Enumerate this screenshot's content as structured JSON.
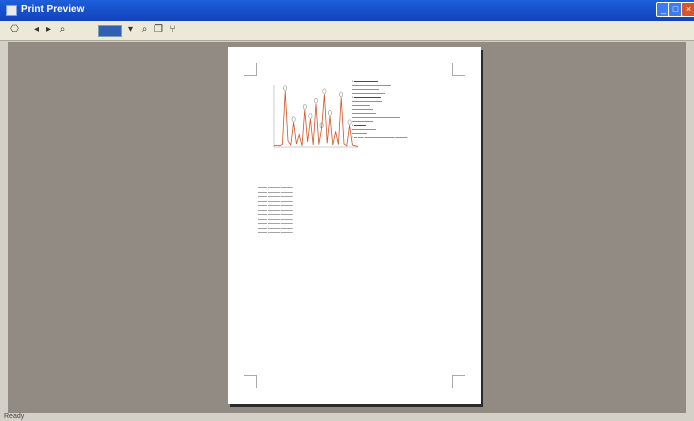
{
  "window": {
    "title": "Print Preview",
    "controls": [
      "minimize",
      "maximize",
      "close"
    ],
    "accent": "#1d5fdc"
  },
  "toolbar": {
    "buttons": [
      {
        "icon": "print-icon",
        "glyph": "⎔"
      },
      {
        "icon": "nav-back-icon",
        "glyph": "◂"
      },
      {
        "icon": "nav-forward-icon",
        "glyph": "▸"
      },
      {
        "icon": "zoom-in-icon",
        "glyph": "⌕"
      },
      {
        "icon": "zoom-select-icon",
        "glyph": ""
      },
      {
        "icon": "zoom-dropdown-icon",
        "glyph": "▾"
      },
      {
        "icon": "zoom-out-icon",
        "glyph": "⌕"
      },
      {
        "icon": "page-setup-icon",
        "glyph": "❐"
      },
      {
        "icon": "export-icon",
        "glyph": "⑂"
      }
    ]
  },
  "status": {
    "text": "Ready"
  },
  "page": {
    "chart": {
      "type": "line",
      "colors": {
        "primary": "#d2552a",
        "secondary": "#f0a070",
        "axis": "#999999"
      }
    },
    "legend_markers": [
      "○",
      "○",
      "○",
      "○",
      "○",
      "○",
      "○"
    ]
  },
  "chart_data": {
    "type": "line",
    "x": [
      0,
      1,
      2,
      3,
      4,
      5,
      6,
      7,
      8,
      9,
      10,
      11,
      12,
      13,
      14,
      15,
      16,
      17,
      18,
      19,
      20,
      21,
      22,
      23,
      24,
      25,
      26,
      27,
      28,
      29,
      30
    ],
    "series": [
      {
        "values": [
          2,
          3,
          2,
          4,
          90,
          10,
          3,
          40,
          5,
          20,
          2,
          60,
          8,
          45,
          3,
          70,
          4,
          30,
          85,
          6,
          50,
          3,
          25,
          4,
          80,
          5,
          2,
          35,
          3,
          2,
          1
        ]
      }
    ],
    "ylim": [
      0,
      100
    ],
    "grid": false
  }
}
